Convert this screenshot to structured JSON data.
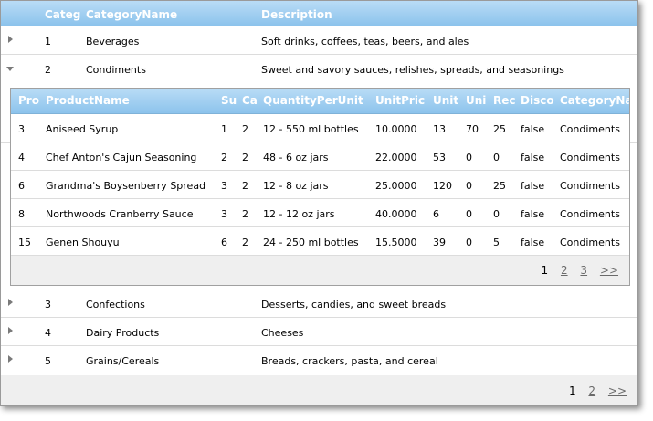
{
  "columns": [
    "Categ",
    "CategoryName",
    "Description"
  ],
  "categories": [
    {
      "id": "1",
      "name": "Beverages",
      "description": "Soft drinks, coffees, teas, beers, and ales"
    },
    {
      "id": "2",
      "name": "Condiments",
      "description": "Sweet and savory sauces, relishes, spreads, and seasonings"
    },
    {
      "id": "3",
      "name": "Confections",
      "description": "Desserts, candies, and sweet breads"
    },
    {
      "id": "4",
      "name": "Dairy Products",
      "description": "Cheeses"
    },
    {
      "id": "5",
      "name": "Grains/Cereals",
      "description": "Breads, crackers, pasta, and cereal"
    }
  ],
  "detail": {
    "columns": [
      "Pro",
      "ProductName",
      "Su",
      "Ca",
      "QuantityPerUnit",
      "UnitPric",
      "Unit",
      "Uni",
      "Rec",
      "Disco",
      "CategoryNa"
    ],
    "rows": [
      [
        "3",
        "Aniseed Syrup",
        "1",
        "2",
        "12 - 550 ml bottles",
        "10.0000",
        "13",
        "70",
        "25",
        "false",
        "Condiments"
      ],
      [
        "4",
        "Chef Anton's Cajun Seasoning",
        "2",
        "2",
        "48 - 6 oz jars",
        "22.0000",
        "53",
        "0",
        "0",
        "false",
        "Condiments"
      ],
      [
        "6",
        "Grandma's Boysenberry Spread",
        "3",
        "2",
        "12 - 8 oz jars",
        "25.0000",
        "120",
        "0",
        "25",
        "false",
        "Condiments"
      ],
      [
        "8",
        "Northwoods Cranberry Sauce",
        "3",
        "2",
        "12 - 12 oz jars",
        "40.0000",
        "6",
        "0",
        "0",
        "false",
        "Condiments"
      ],
      [
        "15",
        "Genen Shouyu",
        "6",
        "2",
        "24 - 250 ml bottles",
        "15.5000",
        "39",
        "0",
        "5",
        "false",
        "Condiments"
      ]
    ],
    "pager": [
      "1",
      "2",
      "3",
      ">>"
    ]
  },
  "pager": [
    "1",
    "2",
    ">>"
  ],
  "colors": {
    "header_top": "#b9dcf6",
    "header_bottom": "#8cc3ec",
    "pager_link": "#6a6a6a"
  }
}
